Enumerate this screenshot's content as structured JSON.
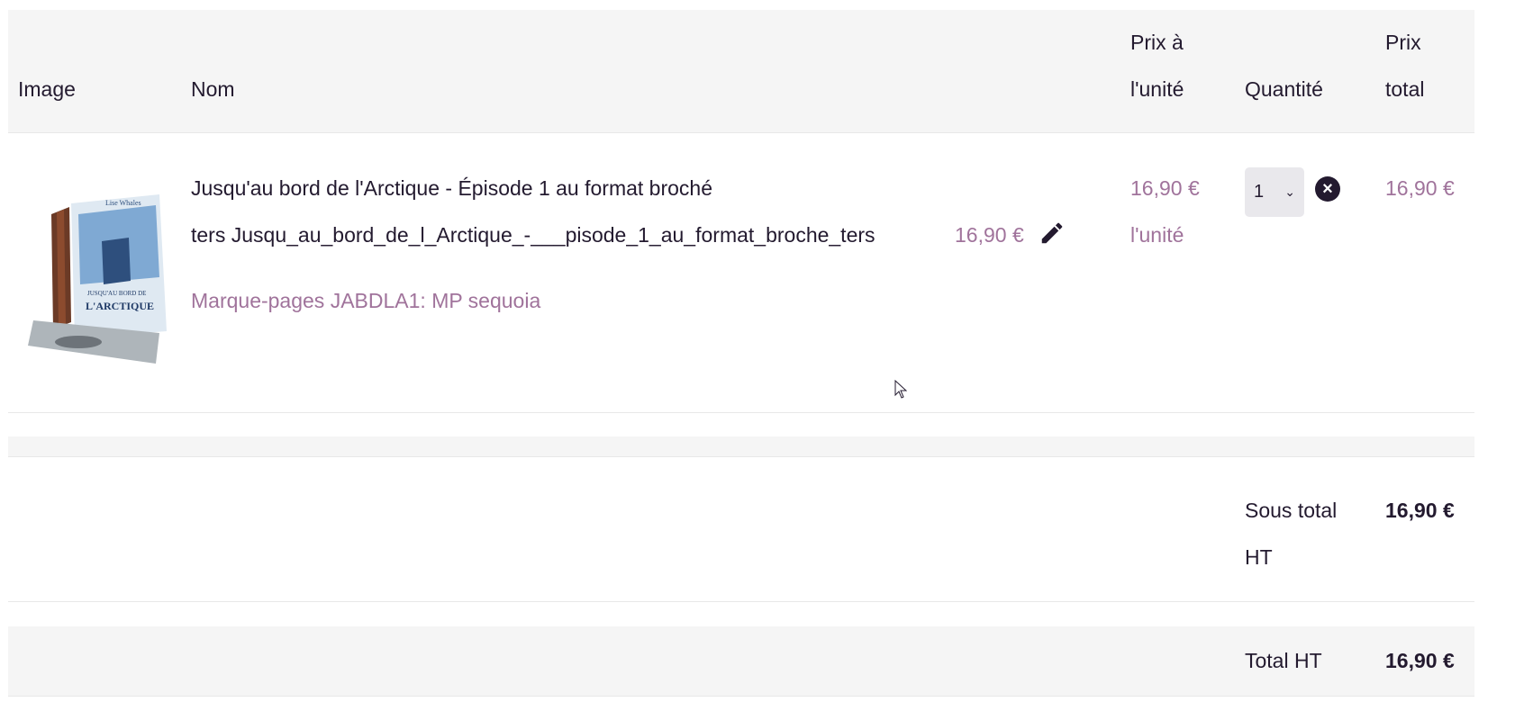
{
  "header": {
    "image": "Image",
    "name": "Nom",
    "unit_price_line1": "Prix à",
    "unit_price_line2": "l'unité",
    "quantity": "Quantité",
    "total_price_line1": "Prix",
    "total_price_line2": "total"
  },
  "item": {
    "title": "Jusqu'au bord de l'Arctique - Épisode 1 au format broché",
    "variant_prefix": "ters Jusqu_au_bord_de_l_Arctique_-___pisode_1_au_format_broche_ters",
    "variant_price": "16,90 €",
    "bookmark_link": "Marque-pages JABDLA1: MP sequoia",
    "unit_price": "16,90 €",
    "unit_price_suffix": "l'unité",
    "quantity": "1",
    "total_price": "16,90 €",
    "cover_title_line1": "JUSQU'AU BORD DE",
    "cover_title_line2": "L'ARCTIQUE",
    "cover_author": "Lise Whales",
    "icons": {
      "edit": "pencil-icon",
      "remove": "close-circle-icon",
      "chevron": "chevron-down-icon"
    }
  },
  "summary": {
    "subtotal_label_line1": "Sous total",
    "subtotal_label_line2": "HT",
    "subtotal_value": "16,90 €",
    "total_label": "Total HT",
    "total_value": "16,90 €"
  },
  "colors": {
    "accent": "#a0739b",
    "text": "#231a2f",
    "stripe": "#f5f5f5"
  }
}
